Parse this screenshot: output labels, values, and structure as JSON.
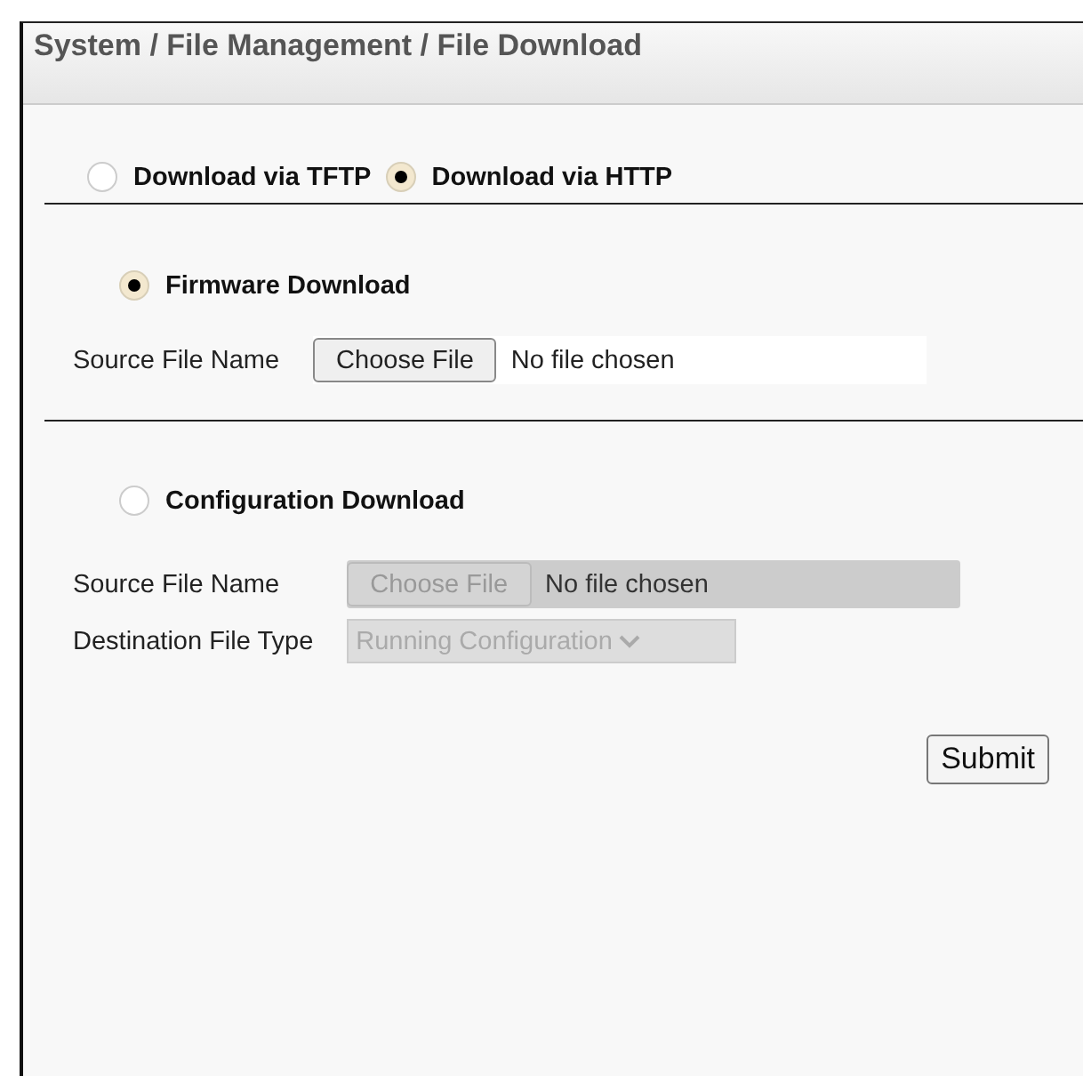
{
  "breadcrumb": "System / File Management / File Download",
  "protocols": [
    {
      "label": "Download via TFTP",
      "selected": false
    },
    {
      "label": "Download via HTTP",
      "selected": true
    }
  ],
  "sections": [
    {
      "label": "Firmware Download",
      "selected": true,
      "disabled": false,
      "fields": [
        {
          "kind": "file",
          "label": "Source File Name",
          "button": "Choose File",
          "value": "No file chosen"
        }
      ]
    },
    {
      "label": "Configuration Download",
      "selected": false,
      "disabled": true,
      "fields": [
        {
          "kind": "file",
          "label": "Source File Name",
          "button": "Choose File",
          "value": "No file chosen"
        },
        {
          "kind": "select",
          "label": "Destination File Type",
          "value": "Running Configuration"
        }
      ]
    }
  ],
  "submit": "Submit"
}
